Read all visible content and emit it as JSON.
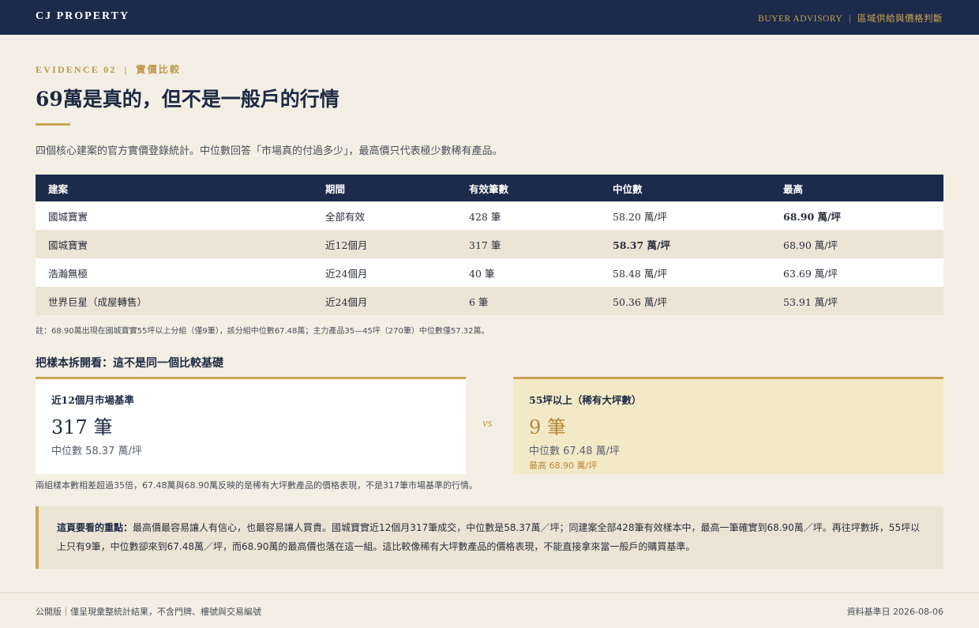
{
  "header": {
    "brand": "CJ PROPERTY",
    "advisory_label": "BUYER ADVISORY",
    "advisory_sep": "|",
    "advisory_topic": "區域供給與價格判斷"
  },
  "section": {
    "evidence_label": "EVIDENCE 02",
    "evidence_sep": "|",
    "evidence_topic": "實價比較",
    "title": "69萬是真的，但不是一般戶的行情",
    "intro": "四個核心建案的官方實價登錄統計。中位數回答「市場真的付過多少」，最高價只代表極少數稀有產品。"
  },
  "table": {
    "headers": [
      "建案",
      "期間",
      "有效筆數",
      "中位數",
      "最高"
    ],
    "rows": [
      [
        "國城寶實",
        "全部有效",
        "428 筆",
        "58.20 萬/坪",
        "68.90 萬/坪"
      ],
      [
        "國城寶實",
        "近12個月",
        "317 筆",
        "58.37 萬/坪",
        "68.90 萬/坪"
      ],
      [
        "浩瀚無極",
        "近24個月",
        "40 筆",
        "58.48 萬/坪",
        "63.69 萬/坪"
      ],
      [
        "世界巨星（成屋轉售）",
        "近24個月",
        "6 筆",
        "50.36 萬/坪",
        "53.91 萬/坪"
      ]
    ],
    "note": "註：68.90萬出現在國城寶實55坪以上分組（僅9筆），該分組中位數67.48萬；主力產品35—45坪（270筆）中位數僅57.32萬。"
  },
  "comparison": {
    "heading": "把樣本拆開看：這不是同一個比較基礎",
    "left": {
      "label": "近12個月市場基準",
      "count": "317 筆",
      "median": "中位數 58.37 萬/坪"
    },
    "vs": "vs",
    "right": {
      "label": "55坪以上（稀有大坪數）",
      "count": "9 筆",
      "median": "中位數 67.48 萬/坪",
      "max": "最高 68.90 萬/坪"
    },
    "gap_note": "兩組樣本數相差超過35倍，67.48萬與68.90萬反映的是稀有大坪數產品的價格表現，不是317筆市場基準的行情。"
  },
  "callout": {
    "lead": "這頁要看的重點：",
    "body": "最高價最容易讓人有信心，也最容易讓人買貴。國城寶實近12個月317筆成交，中位數是58.37萬／坪；同建案全部428筆有效樣本中，最高一筆確實到68.90萬／坪。再往坪數拆，55坪以上只有9筆，中位數卻來到67.48萬／坪，而68.90萬的最高價也落在這一組。這比較像稀有大坪數產品的價格表現，不能直接拿來當一般戶的購買基準。"
  },
  "footer": {
    "left": "公開版｜僅呈現彙整統計結果，不含門牌、樓號與交易編號",
    "right": "資料基準日 2026-08-06"
  },
  "colors": {
    "navy": "#1c2a4b",
    "gold": "#c9a553",
    "background": "#f3efe5",
    "highlight_card": "#f4e9c6"
  }
}
